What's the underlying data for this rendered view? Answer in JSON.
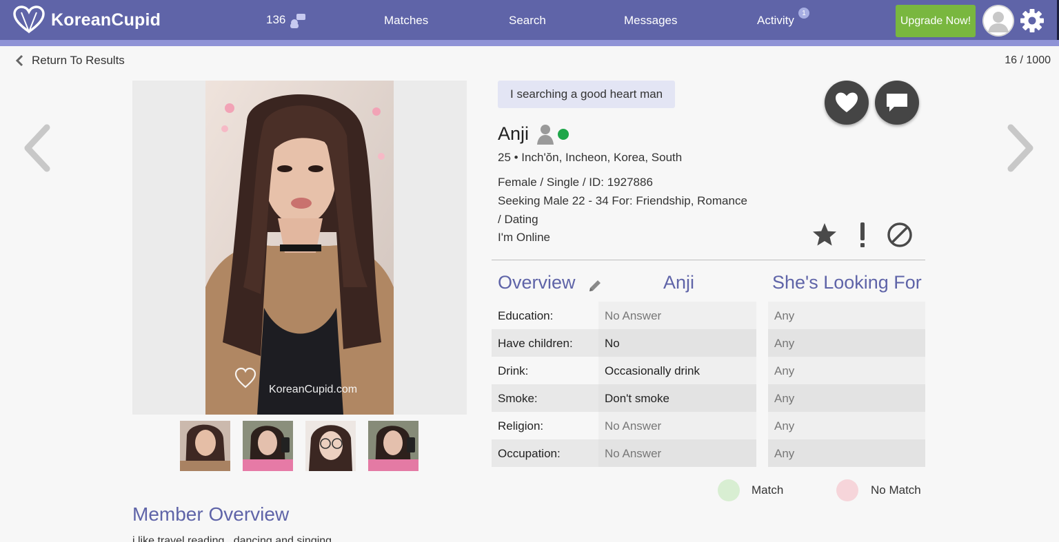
{
  "brand": {
    "name": "KoreanCupid"
  },
  "nav": {
    "count": "136",
    "links": [
      "Matches",
      "Search",
      "Messages",
      "Activity"
    ],
    "activity_badge": "1",
    "upgrade": "Upgrade Now!"
  },
  "top": {
    "back": "Return To Results",
    "pager": "16 / 1000"
  },
  "photo": {
    "watermark": "KoreanCupid.com"
  },
  "profile": {
    "tagline": "I searching a good heart man",
    "name": "Anji",
    "location": "25 • Inch'ŏn, Incheon, Korea, South",
    "details": "Female / Single / ID: 1927886",
    "seeking_1": "Seeking Male 22 - 34 For: Friendship, Romance",
    "seeking_2": "/ Dating",
    "status": "I'm Online"
  },
  "overview": {
    "heading": "Overview",
    "col_self": "Anji",
    "col_want": "She's Looking For",
    "rows": [
      {
        "label": "Education:",
        "self": "No Answer",
        "want": "Any"
      },
      {
        "label": "Have children:",
        "self": "No",
        "want": "Any"
      },
      {
        "label": "Drink:",
        "self": "Occasionally drink",
        "want": "Any"
      },
      {
        "label": "Smoke:",
        "self": "Don't smoke",
        "want": "Any"
      },
      {
        "label": "Religion:",
        "self": "No Answer",
        "want": "Any"
      },
      {
        "label": "Occupation:",
        "self": "No Answer",
        "want": "Any"
      }
    ]
  },
  "legend": {
    "match": "Match",
    "no_match": "No Match"
  },
  "member": {
    "heading": "Member Overview",
    "text": "i like travel,reading , dancing and singing"
  },
  "colors": {
    "brand": "#5f64a8",
    "accent": "#8f93d6",
    "upgrade": "#79b73f",
    "online": "#1fa64a",
    "match": "#d8eed2",
    "no_match": "#f6d5da"
  }
}
